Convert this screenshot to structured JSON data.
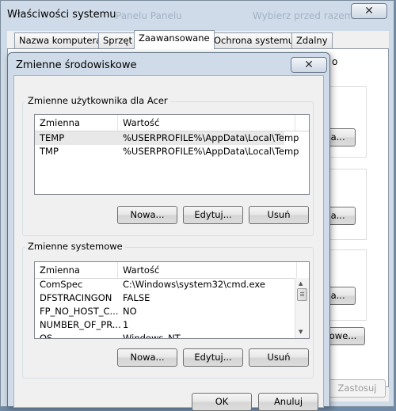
{
  "outer": {
    "title": "Właściwości systemu",
    "ghost_text": "Panelu Panelu",
    "ghost_text2": "Wybierz przed razem",
    "tabs": [
      "Nazwa komputera",
      "Sprzęt",
      "Zaawansowane",
      "Ochrona systemu",
      "Zdalny"
    ],
    "peek_text_1": "o",
    "peek_btn_1": "ia...",
    "peek_btn_2": "ia...",
    "peek_btn_3": "ia...",
    "peek_btn_env": "owe...",
    "apply_label": "Zastosuj"
  },
  "dialog": {
    "title": "Zmienne środowiskowe",
    "user_group": {
      "label": "Zmienne użytkownika dla Acer",
      "columns": [
        "Zmienna",
        "Wartość"
      ],
      "rows": [
        {
          "name": "TEMP",
          "value": "%USERPROFILE%\\AppData\\Local\\Temp"
        },
        {
          "name": "TMP",
          "value": "%USERPROFILE%\\AppData\\Local\\Temp"
        }
      ],
      "buttons": {
        "new": "Nowa...",
        "edit": "Edytuj...",
        "delete": "Usuń"
      }
    },
    "system_group": {
      "label": "Zmienne systemowe",
      "columns": [
        "Zmienna",
        "Wartość"
      ],
      "rows": [
        {
          "name": "ComSpec",
          "value": "C:\\Windows\\system32\\cmd.exe"
        },
        {
          "name": "DFSTRACINGON",
          "value": "FALSE"
        },
        {
          "name": "FP_NO_HOST_C...",
          "value": "NO"
        },
        {
          "name": "NUMBER_OF_PR...",
          "value": "1"
        },
        {
          "name": "OS",
          "value": "Windows_NT"
        }
      ],
      "buttons": {
        "new": "Nowa...",
        "edit": "Edytuj...",
        "delete": "Usuń"
      }
    },
    "ok_label": "OK",
    "cancel_label": "Anuluj"
  }
}
